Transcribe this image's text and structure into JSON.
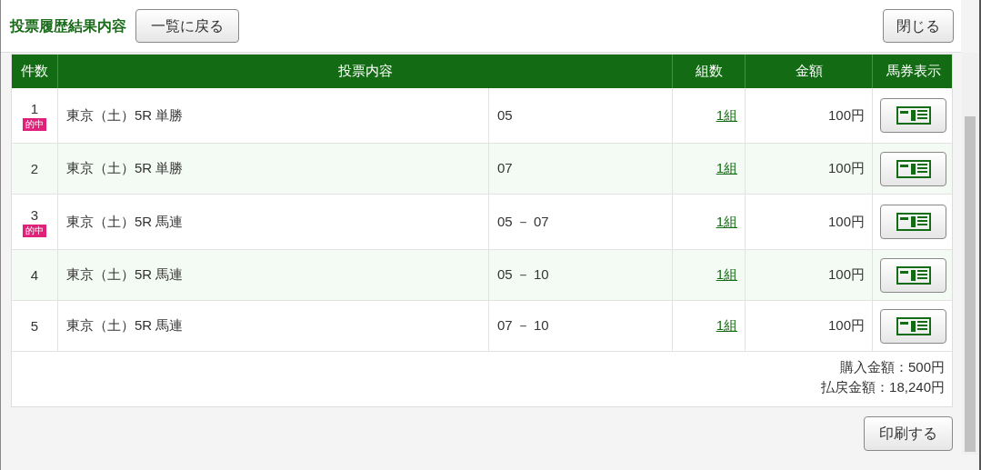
{
  "header": {
    "title": "投票履歴結果内容",
    "back_button": "一覧に戻る",
    "close_button": "閉じる"
  },
  "table": {
    "columns": [
      "件数",
      "投票内容",
      "組数",
      "金額",
      "馬券表示"
    ],
    "rows": [
      {
        "number": "1",
        "hit": true,
        "hit_label": "的中",
        "race": "東京（土）5R 単勝",
        "horses": "05",
        "combos": "1組",
        "amount": "100円"
      },
      {
        "number": "2",
        "hit": false,
        "race": "東京（土）5R 単勝",
        "horses": "07",
        "combos": "1組",
        "amount": "100円"
      },
      {
        "number": "3",
        "hit": true,
        "hit_label": "的中",
        "race": "東京（土）5R 馬連",
        "horses": "05 － 07",
        "combos": "1組",
        "amount": "100円"
      },
      {
        "number": "4",
        "hit": false,
        "race": "東京（土）5R 馬連",
        "horses": "05 － 10",
        "combos": "1組",
        "amount": "100円"
      },
      {
        "number": "5",
        "hit": false,
        "race": "東京（土）5R 馬連",
        "horses": "07 － 10",
        "combos": "1組",
        "amount": "100円"
      }
    ],
    "summary": [
      "購入金額：500円",
      "払戻金額：18,240円"
    ]
  },
  "print_button": "印刷する"
}
